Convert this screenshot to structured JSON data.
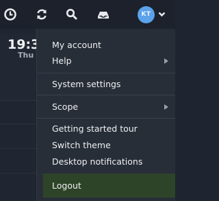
{
  "clock": {
    "time": "19:3",
    "day": "Thu"
  },
  "user": {
    "initials": "KT"
  },
  "menu": {
    "items": [
      {
        "label": "My account",
        "submenu": false
      },
      {
        "label": "Help",
        "submenu": true
      },
      {
        "label": "System settings",
        "submenu": false
      },
      {
        "label": "Scope",
        "submenu": true
      },
      {
        "label": "Getting started tour",
        "submenu": false
      },
      {
        "label": "Switch theme",
        "submenu": false
      },
      {
        "label": "Desktop notifications",
        "submenu": false
      }
    ],
    "logout": "Logout"
  },
  "colors": {
    "background": "#1e2430",
    "menu_bg": "#282e38",
    "logout_bg": "#2e4429",
    "avatar": "#5ba2ea"
  },
  "icons": [
    "clock-icon",
    "sync-icon",
    "search-icon",
    "inbox-icon",
    "chevron-down-icon"
  ]
}
